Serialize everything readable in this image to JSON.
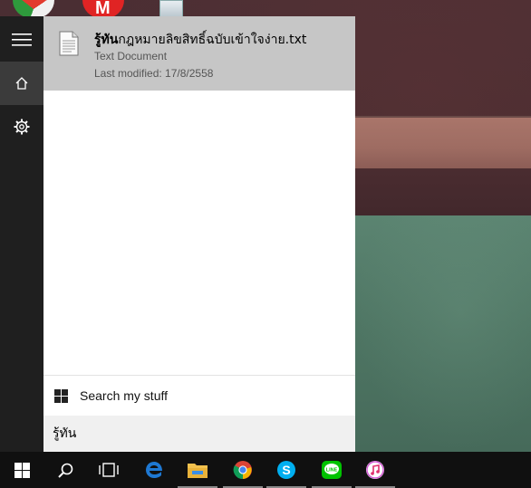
{
  "rail": {
    "items": [
      {
        "icon": "hamburger-menu-icon"
      },
      {
        "icon": "home-icon"
      },
      {
        "icon": "gear-icon"
      }
    ]
  },
  "result": {
    "title_bold": "รู้ทัน",
    "title_rest": "กฎหมายลิขสิทธิ์ฉบับเข้าใจง่าย.txt",
    "type": "Text Document",
    "modified": "Last modified: 17/8/2558",
    "icon": "text-file-icon"
  },
  "search_stuff": {
    "label": "Search my stuff",
    "icon": "windows-logo-icon"
  },
  "search": {
    "value": "รู้ทัน"
  },
  "taskbar": {
    "items": [
      {
        "icon": "windows-start-icon"
      },
      {
        "icon": "search-icon"
      },
      {
        "icon": "task-view-icon"
      },
      {
        "icon": "edge-icon"
      },
      {
        "icon": "file-explorer-icon"
      },
      {
        "icon": "chrome-icon"
      },
      {
        "icon": "skype-icon"
      },
      {
        "icon": "line-icon"
      },
      {
        "icon": "itunes-icon"
      }
    ]
  },
  "colors": {
    "rail_bg": "#1f1f1f",
    "result_bg": "#c6c6c6",
    "taskbar_bg": "#101010",
    "edge_blue": "#1e78d2",
    "skype_blue": "#00aff0",
    "line_green": "#00c300"
  }
}
